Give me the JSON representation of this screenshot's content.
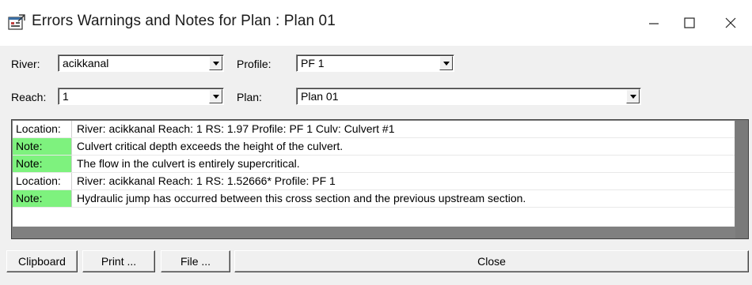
{
  "window": {
    "title": "Errors Warnings and Notes for Plan : Plan 01",
    "minimize_icon": "minimize-icon",
    "maximize_icon": "maximize-icon",
    "close_icon": "close-icon"
  },
  "filters": {
    "river_label": "River:",
    "river_value": "acikkanal",
    "profile_label": "Profile:",
    "profile_value": "PF 1",
    "reach_label": "Reach:",
    "reach_value": "1",
    "plan_label": "Plan:",
    "plan_value": "Plan 01"
  },
  "messages": [
    {
      "type": "Location:",
      "text": "River: acikkanal  Reach: 1    RS: 1.97    Profile: PF 1     Culv: Culvert #1",
      "highlight": false
    },
    {
      "type": "Note:",
      "text": "Culvert critical depth exceeds the height of the culvert.",
      "highlight": true
    },
    {
      "type": "Note:",
      "text": "The flow in the culvert is entirely supercritical.",
      "highlight": true
    },
    {
      "type": "Location:",
      "text": "River: acikkanal  Reach: 1    RS: 1.52666*    Profile: PF 1",
      "highlight": false
    },
    {
      "type": "Note:",
      "text": "Hydraulic jump has occurred between this cross section and the previous upstream section.",
      "highlight": true
    }
  ],
  "buttons": {
    "clipboard": "Clipboard",
    "print": "Print ...",
    "file": "File ...",
    "close": "Close"
  },
  "colors": {
    "note_highlight": "#7ef27e",
    "grid_background": "#808080"
  }
}
